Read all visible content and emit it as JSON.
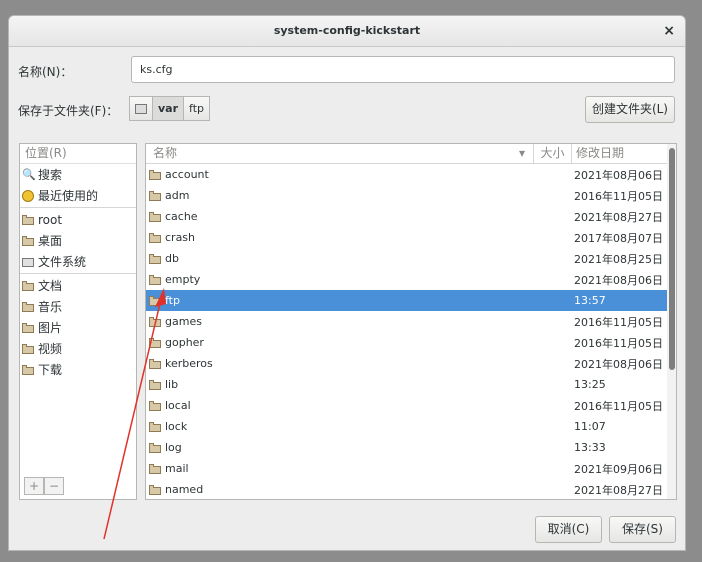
{
  "window": {
    "title": "system-config-kickstart"
  },
  "name_field": {
    "label": "名称(N)：",
    "value": "ks.cfg"
  },
  "save_in": {
    "label": "保存于文件夹(F)：",
    "path": [
      "var",
      "ftp"
    ],
    "create_folder_label": "创建文件夹(L)"
  },
  "places": {
    "header": "位置(R)",
    "items": [
      {
        "label": "搜索",
        "icon": "search-icon"
      },
      {
        "label": "最近使用的",
        "icon": "recent-icon"
      },
      {
        "label": "root",
        "icon": "home-folder-icon"
      },
      {
        "label": "桌面",
        "icon": "desktop-folder-icon"
      },
      {
        "label": "文件系统",
        "icon": "drive-icon"
      },
      {
        "label": "文档",
        "icon": "documents-folder-icon"
      },
      {
        "label": "音乐",
        "icon": "music-folder-icon"
      },
      {
        "label": "图片",
        "icon": "pictures-folder-icon"
      },
      {
        "label": "视频",
        "icon": "videos-folder-icon"
      },
      {
        "label": "下载",
        "icon": "downloads-folder-icon"
      }
    ],
    "add_label": "+",
    "remove_label": "−"
  },
  "file_list": {
    "columns": {
      "name": "名称",
      "size": "大小",
      "modified": "修改日期"
    },
    "rows": [
      {
        "name": "account",
        "modified": "2021年08月06日"
      },
      {
        "name": "adm",
        "modified": "2016年11月05日"
      },
      {
        "name": "cache",
        "modified": "2021年08月27日"
      },
      {
        "name": "crash",
        "modified": "2017年08月07日"
      },
      {
        "name": "db",
        "modified": "2021年08月25日"
      },
      {
        "name": "empty",
        "modified": "2021年08月06日"
      },
      {
        "name": "ftp",
        "modified": "13:57",
        "selected": true
      },
      {
        "name": "games",
        "modified": "2016年11月05日"
      },
      {
        "name": "gopher",
        "modified": "2016年11月05日"
      },
      {
        "name": "kerberos",
        "modified": "2021年08月06日"
      },
      {
        "name": "lib",
        "modified": "13:25"
      },
      {
        "name": "local",
        "modified": "2016年11月05日"
      },
      {
        "name": "lock",
        "modified": "11:07"
      },
      {
        "name": "log",
        "modified": "13:33"
      },
      {
        "name": "mail",
        "modified": "2021年09月06日"
      },
      {
        "name": "named",
        "modified": "2021年08月27日"
      }
    ]
  },
  "buttons": {
    "cancel": "取消(C)",
    "save": "保存(S)"
  },
  "colors": {
    "selection": "#4a90d9",
    "annotation_arrow": "#e0322a"
  }
}
